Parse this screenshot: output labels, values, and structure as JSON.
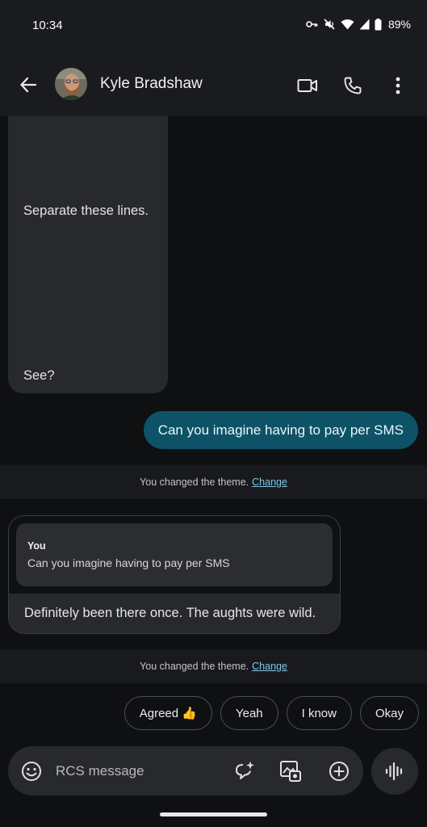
{
  "status_bar": {
    "time": "10:34",
    "battery_percent": "89%",
    "icons": [
      "vpn-key-icon",
      "mute-icon",
      "wifi-icon",
      "signal-icon",
      "battery-icon"
    ]
  },
  "app_bar": {
    "contact_name": "Kyle Bradshaw",
    "back_icon": "arrow-back-icon",
    "actions": [
      "video-call-icon",
      "phone-icon",
      "more-vert-icon"
    ]
  },
  "messages": {
    "incoming_1": {
      "line1": "Separate these lines.",
      "line2": "See?"
    },
    "outgoing_1": {
      "text": "Can you imagine having to pay per SMS"
    },
    "system_1": {
      "text": "You changed the theme.",
      "link": "Change"
    },
    "reply_1": {
      "quote_author": "You",
      "quote_text": "Can you imagine having to pay per SMS",
      "text": "Definitely been there once. The aughts were wild."
    },
    "system_2": {
      "text": "You changed the theme.",
      "link": "Change"
    }
  },
  "suggestions": [
    "Agreed 👍",
    "Yeah",
    "I know",
    "Okay"
  ],
  "compose": {
    "placeholder": "RCS message",
    "icons": [
      "emoji-icon",
      "ai-magic-compose-icon",
      "gallery-icon",
      "add-icon",
      "voice-waveform-icon"
    ]
  },
  "colors": {
    "background": "#0f1012",
    "bar": "#1a1b1e",
    "incoming_bubble": "#27292d",
    "outgoing_bubble": "#0e5267",
    "link": "#7fc7e9"
  }
}
